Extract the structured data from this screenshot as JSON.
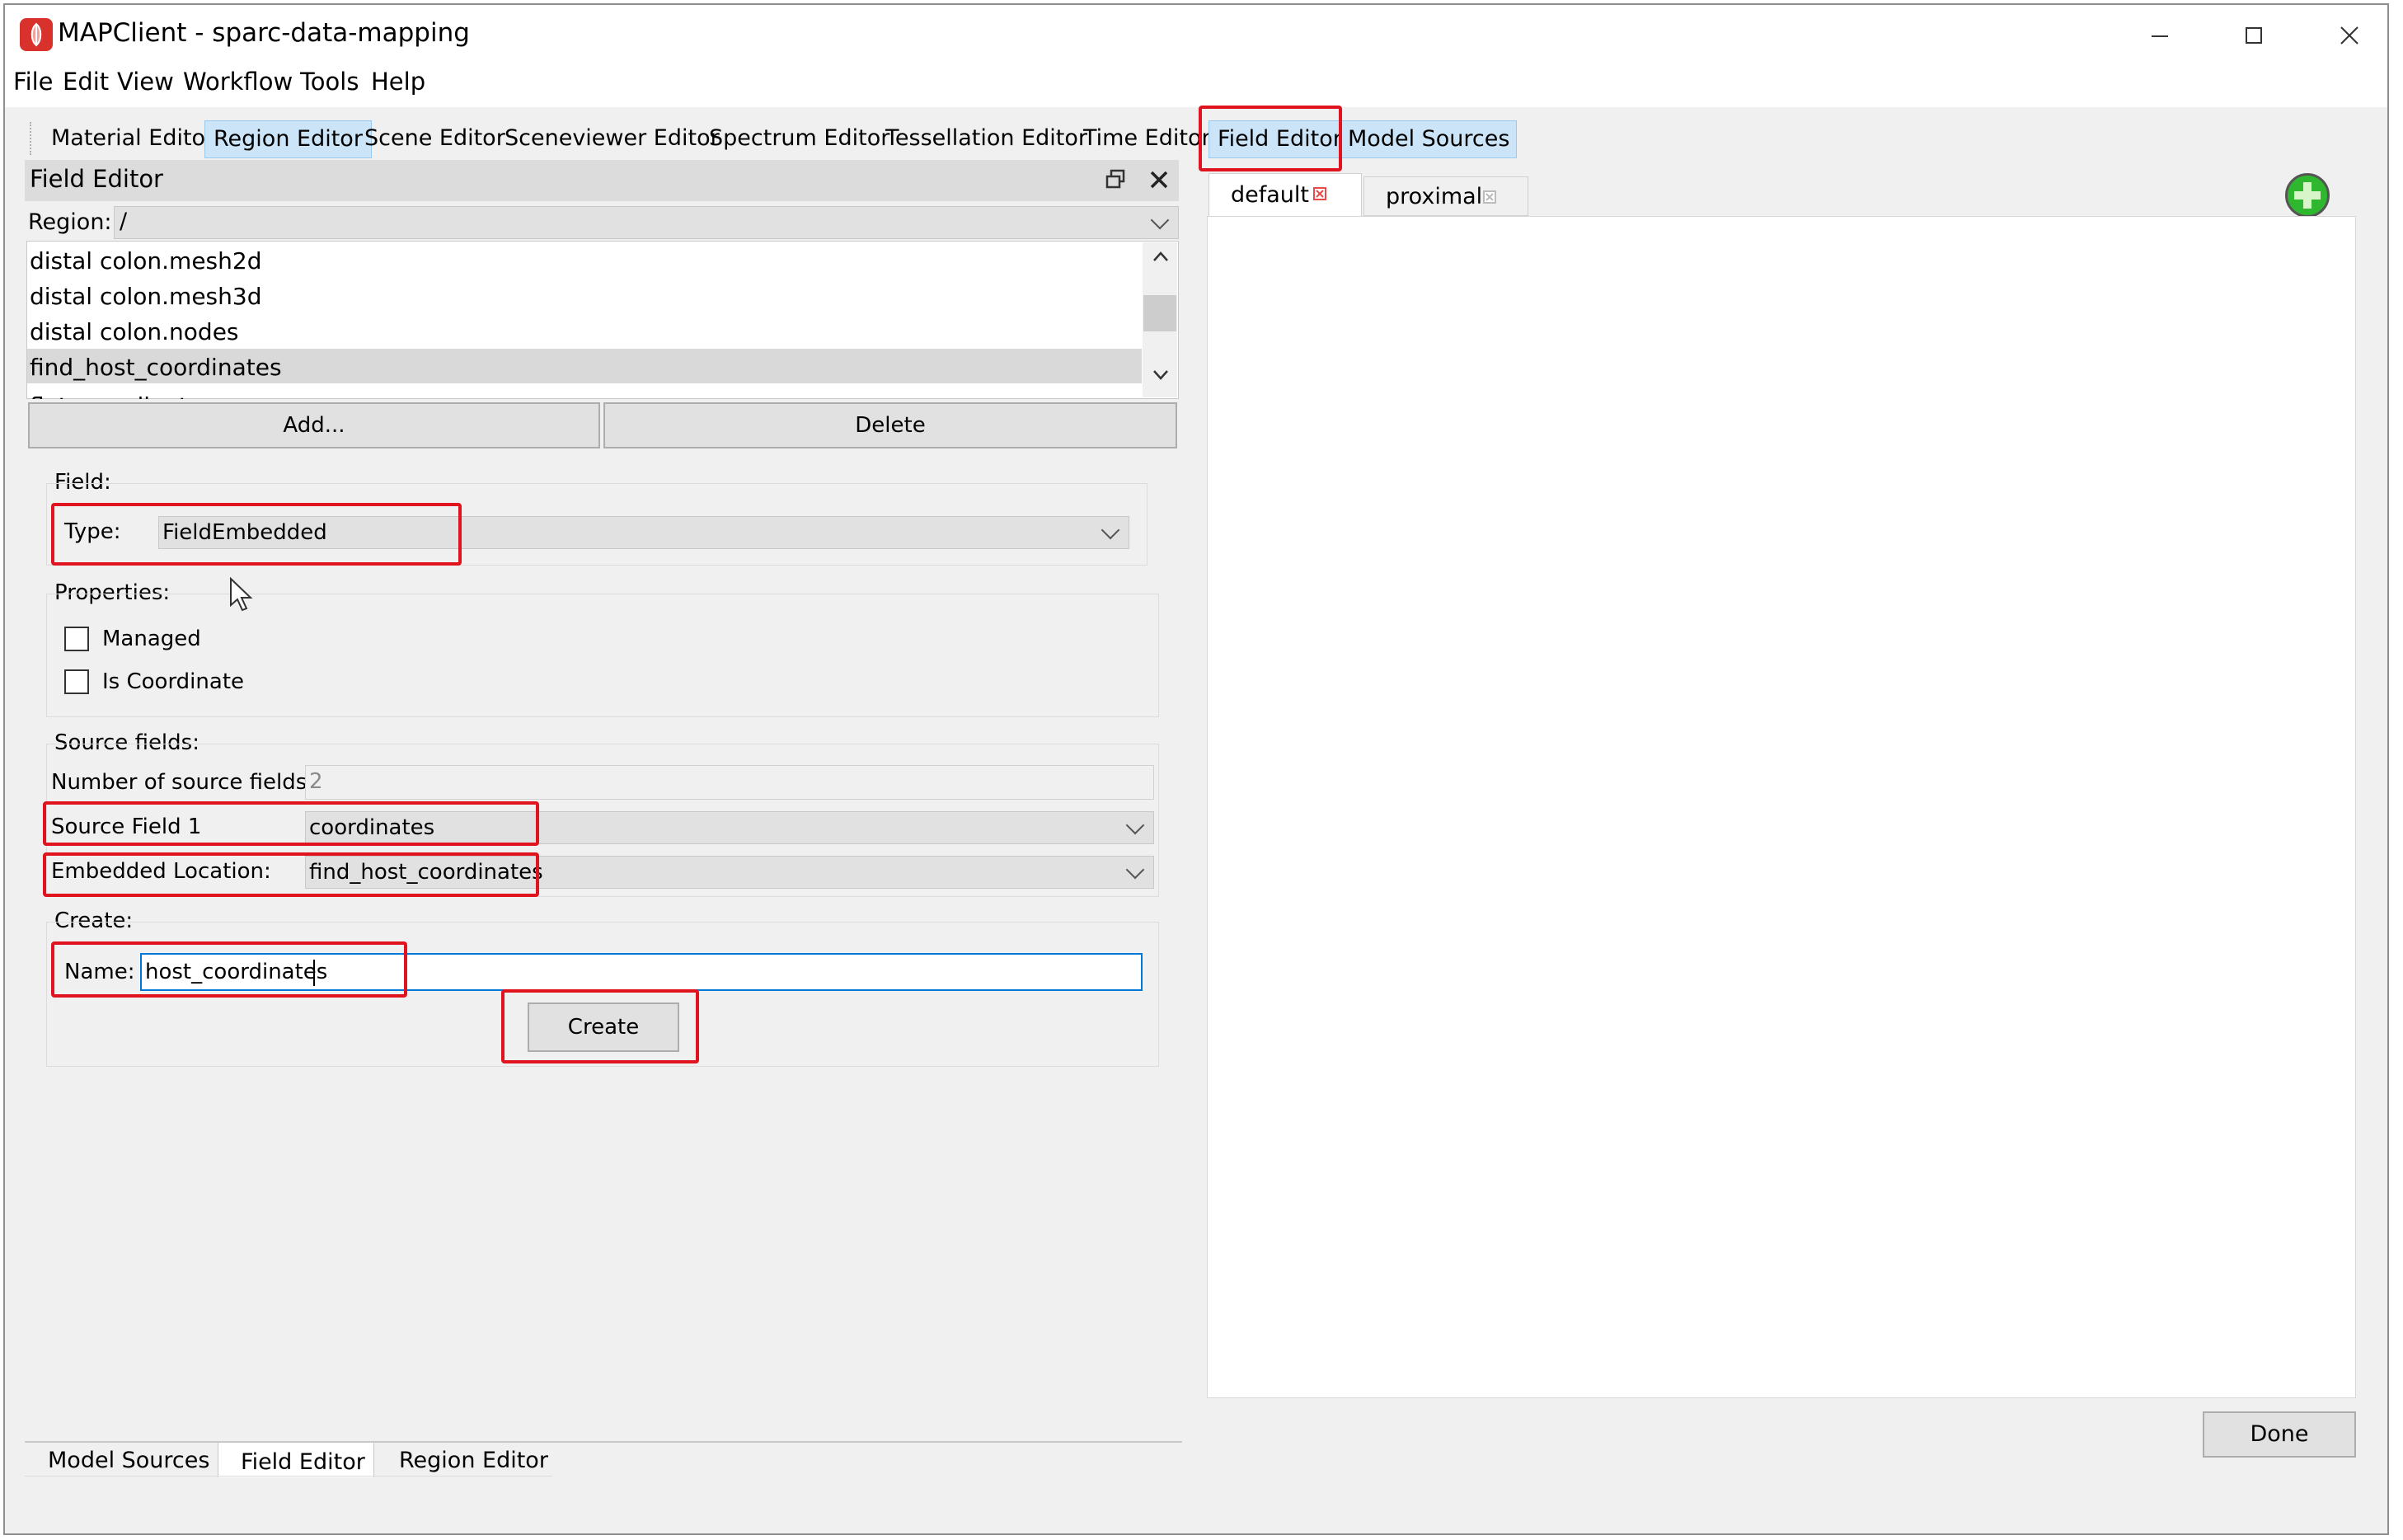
{
  "window": {
    "title": "MAPClient - sparc-data-mapping"
  },
  "menu": [
    "File",
    "Edit",
    "View",
    "Workflow",
    "Tools",
    "Help"
  ],
  "toolbar_tabs": [
    {
      "label": "Material Editor",
      "selected": false
    },
    {
      "label": "Region Editor",
      "selected": true
    },
    {
      "label": "Scene Editor",
      "selected": false
    },
    {
      "label": "Sceneviewer Editor",
      "selected": false
    },
    {
      "label": "Spectrum Editor",
      "selected": false
    },
    {
      "label": "Tessellation Editor",
      "selected": false
    },
    {
      "label": "Time Editor",
      "selected": false
    },
    {
      "label": "Field Editor",
      "selected": true
    },
    {
      "label": "Model Sources",
      "selected": true
    }
  ],
  "dock": {
    "title": "Field Editor",
    "region_label": "Region:",
    "region_value": "/",
    "fields_list": [
      "distal colon.mesh2d",
      "distal colon.mesh3d",
      "distal colon.nodes",
      "find_host_coordinates",
      "flat_coordinates"
    ],
    "selected_index": 3,
    "add_label": "Add...",
    "delete_label": "Delete"
  },
  "field_group": {
    "title": "Field:",
    "type_label": "Type:",
    "type_value": "FieldEmbedded"
  },
  "properties_group": {
    "title": "Properties:",
    "managed_label": "Managed",
    "managed_checked": false,
    "is_coordinate_label": "Is Coordinate",
    "is_coordinate_checked": false
  },
  "source_group": {
    "title": "Source fields:",
    "count_label": "Number of source fields:",
    "count_value": "2",
    "source1_label": "Source Field 1",
    "source1_value": "coordinates",
    "embedded_label": "Embedded Location:",
    "embedded_value": "find_host_coordinates"
  },
  "create_group": {
    "title": "Create:",
    "name_label": "Name:",
    "name_value": "host_coordinates",
    "create_label": "Create"
  },
  "bottom_tabs": [
    {
      "label": "Model Sources",
      "selected": false
    },
    {
      "label": "Field Editor",
      "selected": true
    },
    {
      "label": "Region Editor",
      "selected": false
    }
  ],
  "view_tabs": [
    {
      "label": "default",
      "selected": true
    },
    {
      "label": "proximal",
      "selected": false
    }
  ],
  "done_label": "Done",
  "colors": {
    "highlight": "#e0141e",
    "selected_tab": "#cce4f7",
    "plus_green": "#2fb82f"
  }
}
